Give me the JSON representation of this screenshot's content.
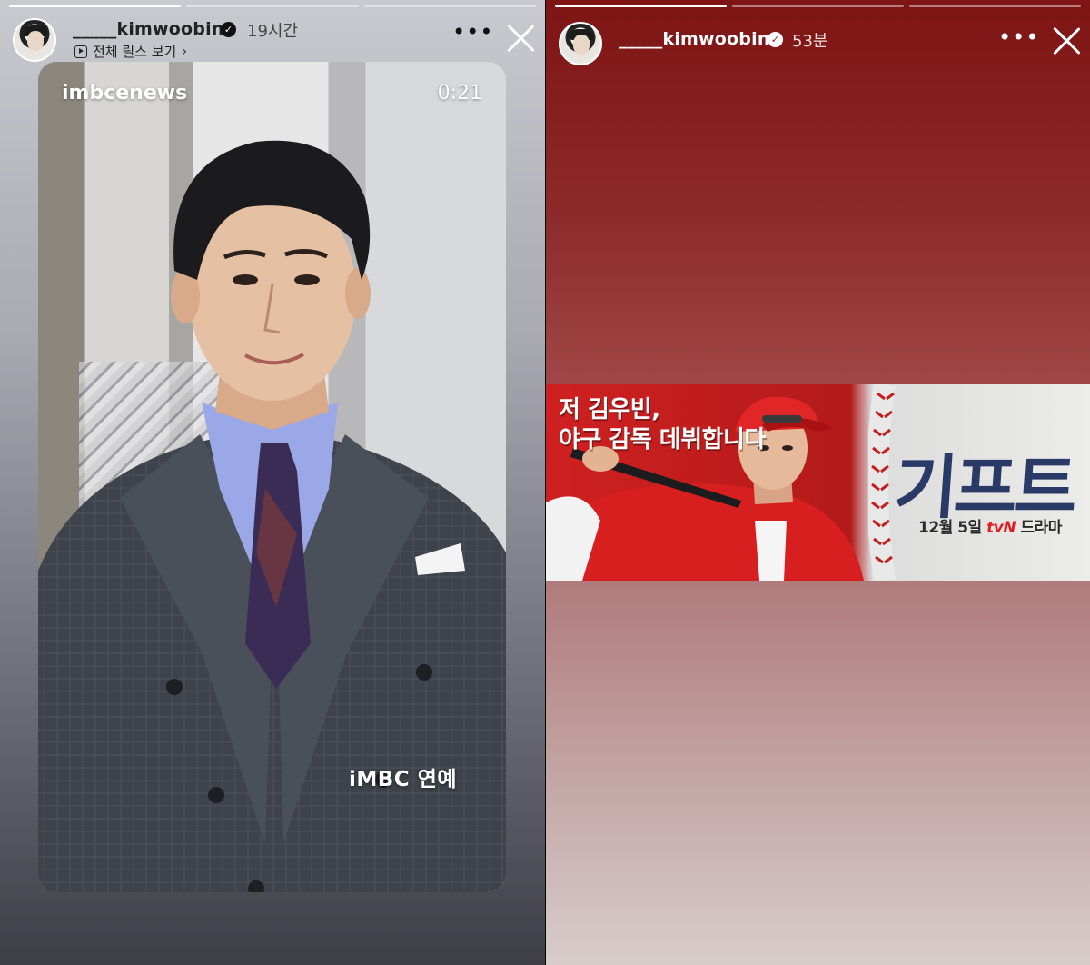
{
  "left_story": {
    "progress_segments": [
      {
        "state": "full"
      },
      {
        "state": "empty"
      },
      {
        "state": "empty"
      }
    ],
    "username": "_____kimwoobin",
    "timestamp": "19시간",
    "reels_link": "전체 릴스 보기",
    "reel": {
      "source": "imbcenews",
      "duration": "0:21",
      "watermark": "iMBC 연예"
    }
  },
  "right_story": {
    "progress_segments": [
      {
        "state": "full"
      },
      {
        "state": "empty"
      },
      {
        "state": "empty"
      }
    ],
    "username": "_____kimwoobin",
    "timestamp": "53분",
    "banner": {
      "tagline_line1": "저 김우빈,",
      "tagline_line2": "야구 감독 데뷔합니다",
      "title": "기프트",
      "airdate_prefix": "12월 5일 ",
      "airdate_channel": "tvN",
      "airdate_suffix": " 드라마"
    }
  },
  "icons": {
    "more": "more-options-icon",
    "close": "close-icon",
    "verified": "verified-badge-icon",
    "reels": "reels-play-icon"
  },
  "colors": {
    "left_bg_top": "#c9cad0",
    "left_bg_bottom": "#3d3e46",
    "right_bg_top": "#7e1414",
    "right_bg_bottom": "#d8cdcb",
    "banner_red": "#cf2020",
    "title_navy": "#2a3a66"
  }
}
